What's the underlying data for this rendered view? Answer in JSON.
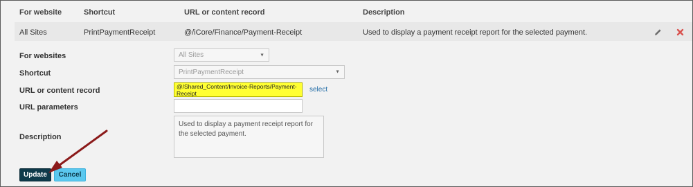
{
  "table": {
    "headers": {
      "website": "For website",
      "shortcut": "Shortcut",
      "url": "URL or content record",
      "description": "Description"
    },
    "row": {
      "website": "All Sites",
      "shortcut": "PrintPaymentReceipt",
      "url": "@/iCore/Finance/Payment-Receipt",
      "description": "Used to display a payment receipt report for the selected payment.",
      "edit_icon": "pencil-icon",
      "delete_icon": "close-icon"
    }
  },
  "form": {
    "websites_label": "For websites",
    "websites_value": "All Sites",
    "shortcut_label": "Shortcut",
    "shortcut_value": "PrintPaymentReceipt",
    "url_label": "URL or content record",
    "url_value": "@/Shared_Content/Invoice-Reports/Payment-Receipt",
    "select_link": "select",
    "params_label": "URL parameters",
    "params_value": "",
    "description_label": "Description",
    "description_value": "Used to display a payment receipt report for the selected payment."
  },
  "buttons": {
    "update": "Update",
    "cancel": "Cancel"
  },
  "colors": {
    "highlight": "#ffff33",
    "update_button": "#0e3a4a",
    "cancel_button": "#5bc8ee",
    "arrow": "#8b1a1a",
    "delete_icon": "#d9534f"
  }
}
